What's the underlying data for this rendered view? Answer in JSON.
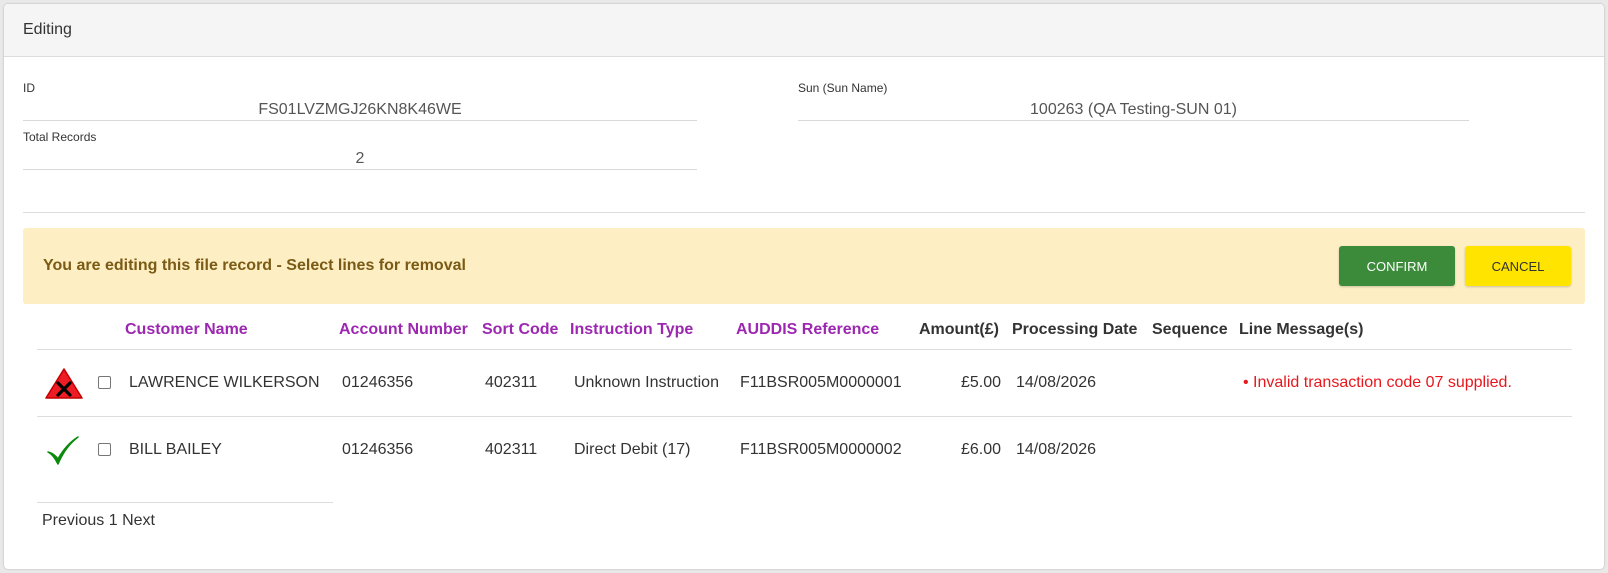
{
  "header": {
    "title": "Editing"
  },
  "fields": {
    "id": {
      "label": "ID",
      "value": "FS01LVZMGJ26KN8K46WE"
    },
    "sun": {
      "label": "Sun (Sun Name)",
      "value": "100263 (QA Testing-SUN 01)"
    },
    "total": {
      "label": "Total Records",
      "value": "2"
    }
  },
  "alert": {
    "message": "You are editing this file record - Select lines for removal",
    "confirm_label": "CONFIRM",
    "cancel_label": "CANCEL"
  },
  "colors": {
    "confirm": "#3c8b3a",
    "cancel": "#ffe400",
    "sortable_header": "#9c27b0",
    "error_text": "#e8171c",
    "alert_bg": "#fdefc3"
  },
  "table": {
    "columns": {
      "customer_name": "Customer Name",
      "account_number": "Account Number",
      "sort_code": "Sort Code",
      "instruction_type": "Instruction Type",
      "auddis_reference": "AUDDIS Reference",
      "amount": "Amount(£)",
      "processing_date": "Processing Date",
      "sequence": "Sequence",
      "line_messages": "Line Message(s)"
    },
    "rows": [
      {
        "status_icon": "error-x-triangle-icon",
        "customer_name": "LAWRENCE WILKERSON",
        "account_number": "01246356",
        "sort_code": "402311",
        "instruction_type": "Unknown Instruction",
        "auddis_reference": "F11BSR005M0000001",
        "amount": "£5.00",
        "processing_date": "14/08/2026",
        "sequence": "",
        "line_message": "• Invalid transaction code 07 supplied."
      },
      {
        "status_icon": "checkmark-icon",
        "customer_name": "BILL BAILEY",
        "account_number": "01246356",
        "sort_code": "402311",
        "instruction_type": "Direct Debit (17)",
        "auddis_reference": "F11BSR005M0000002",
        "amount": "£6.00",
        "processing_date": "14/08/2026",
        "sequence": "",
        "line_message": ""
      }
    ]
  },
  "pagination": {
    "previous": "Previous",
    "page": "1",
    "next": "Next"
  }
}
